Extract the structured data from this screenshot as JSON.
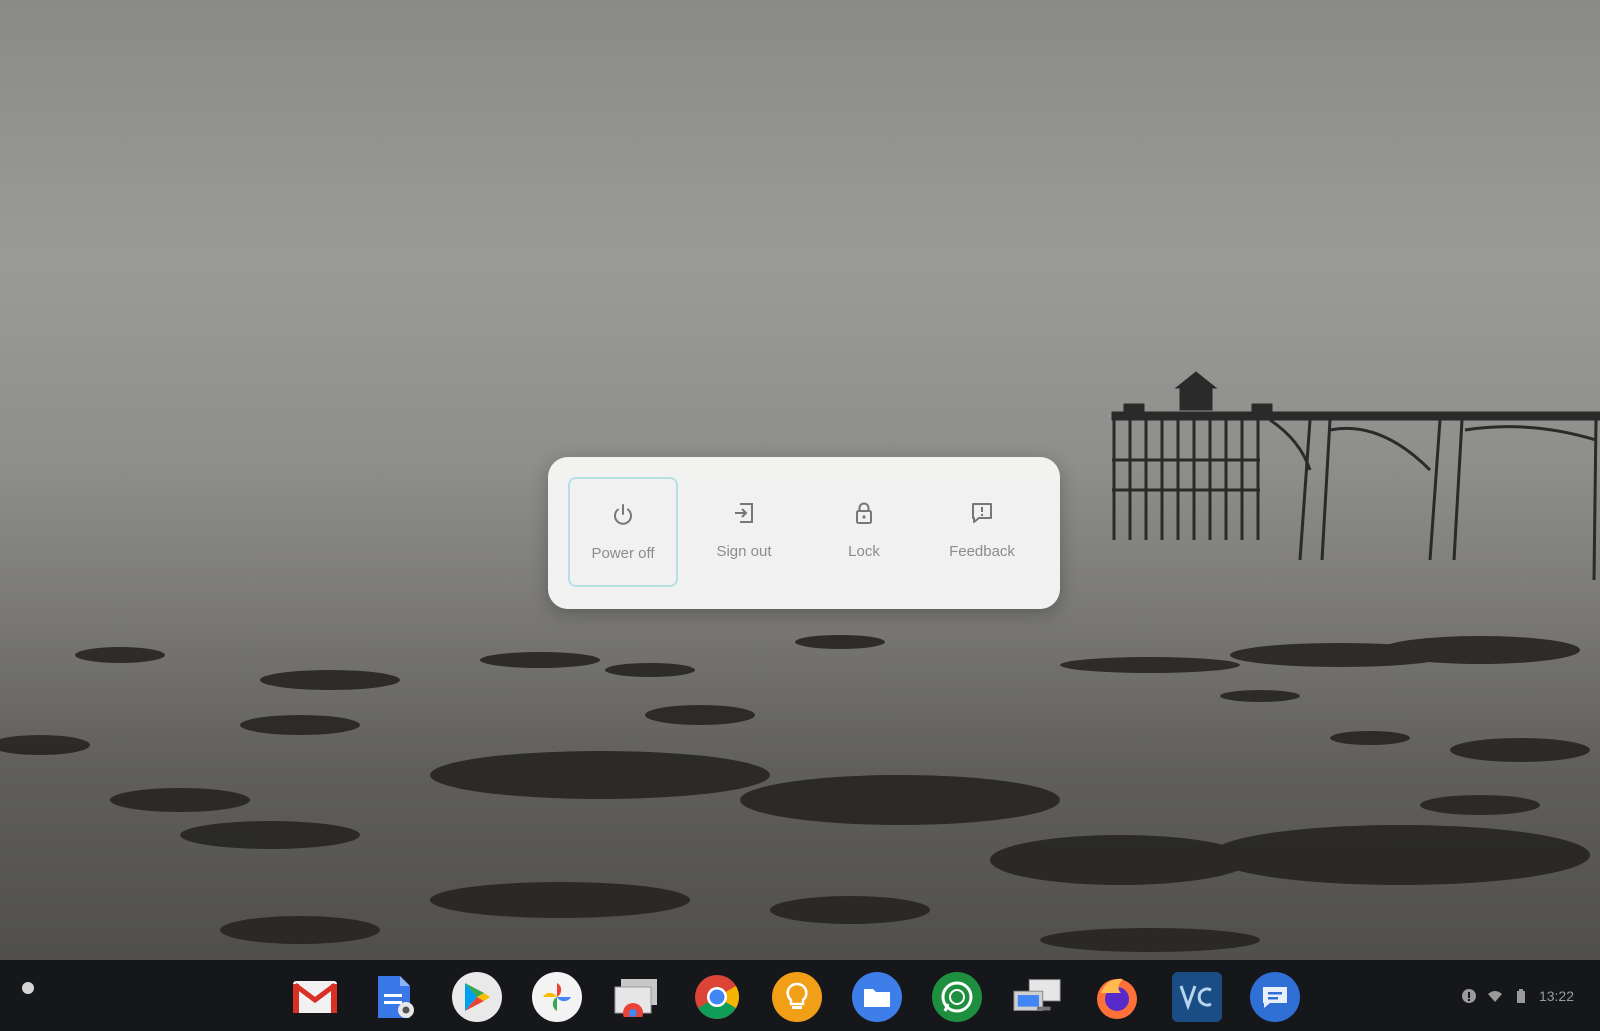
{
  "power_menu": {
    "items": [
      {
        "label": "Power off",
        "icon": "power-icon",
        "focused": true
      },
      {
        "label": "Sign out",
        "icon": "sign-out-icon",
        "focused": false
      },
      {
        "label": "Lock",
        "icon": "lock-icon",
        "focused": false
      },
      {
        "label": "Feedback",
        "icon": "feedback-icon",
        "focused": false
      }
    ]
  },
  "shelf": {
    "apps": [
      {
        "name": "gmail-icon"
      },
      {
        "name": "docs-icon"
      },
      {
        "name": "play-store-icon"
      },
      {
        "name": "photos-icon"
      },
      {
        "name": "screen-cast-icon"
      },
      {
        "name": "chrome-icon"
      },
      {
        "name": "keep-icon"
      },
      {
        "name": "files-icon"
      },
      {
        "name": "whatsapp-icon"
      },
      {
        "name": "remote-desktop-icon"
      },
      {
        "name": "firefox-icon"
      },
      {
        "name": "vscode-icon"
      },
      {
        "name": "messages-icon"
      }
    ],
    "tray": {
      "time": "13:22",
      "icons": [
        "notification-icon",
        "wifi-icon",
        "battery-icon"
      ]
    }
  },
  "colors": {
    "menu_bg": "#f6f6f6",
    "focus_ring": "#b8dfe6",
    "shelf_bg": "#15171a"
  }
}
